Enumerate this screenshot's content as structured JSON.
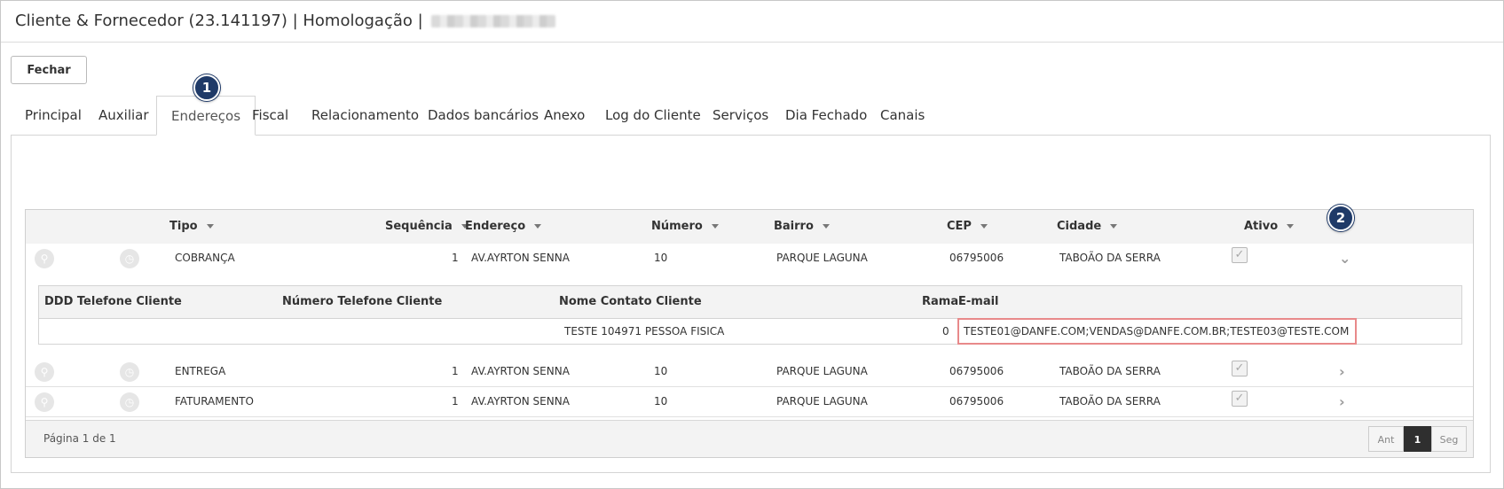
{
  "window": {
    "title": "Cliente & Fornecedor (23.141197) | Homologação |"
  },
  "toolbar": {
    "close_label": "Fechar"
  },
  "tabs": [
    {
      "label": "Principal"
    },
    {
      "label": "Auxiliar"
    },
    {
      "label": "Endereços",
      "active": true
    },
    {
      "label": "Fiscal"
    },
    {
      "label": "Relacionamento"
    },
    {
      "label": "Dados bancários"
    },
    {
      "label": "Anexo"
    },
    {
      "label": "Log do Cliente"
    },
    {
      "label": "Serviços"
    },
    {
      "label": "Dia Fechado"
    },
    {
      "label": "Canais"
    }
  ],
  "markers": [
    "1",
    "2"
  ],
  "grid": {
    "columns": [
      "Tipo",
      "Sequência",
      "Endereço",
      "Número",
      "Bairro",
      "CEP",
      "Cidade",
      "Ativo"
    ],
    "rows": [
      {
        "tipo": "COBRANÇA",
        "sequencia": "1",
        "endereco": "AV.AYRTON SENNA",
        "numero": "10",
        "bairro": "PARQUE LAGUNA",
        "cep": "06795006",
        "cidade": "TABOÃO DA SERRA",
        "ativo": true,
        "expanded": true
      },
      {
        "tipo": "ENTREGA",
        "sequencia": "1",
        "endereco": "AV.AYRTON SENNA",
        "numero": "10",
        "bairro": "PARQUE LAGUNA",
        "cep": "06795006",
        "cidade": "TABOÃO DA SERRA",
        "ativo": true,
        "expanded": false
      },
      {
        "tipo": "FATURAMENTO",
        "sequencia": "1",
        "endereco": "AV.AYRTON SENNA",
        "numero": "10",
        "bairro": "PARQUE LAGUNA",
        "cep": "06795006",
        "cidade": "TABOÃO DA SERRA",
        "ativo": true,
        "expanded": false
      }
    ],
    "detail": {
      "columns": [
        "DDD Telefone Cliente",
        "Número Telefone Cliente",
        "Nome Contato Cliente",
        "Ramal",
        "E-mail"
      ],
      "row": {
        "ddd": "",
        "numero": "",
        "contato": "TESTE 104971 PESSOA FISICA",
        "ramal": "0",
        "email": "TESTE01@DANFE.COM;VENDAS@DANFE.COM.BR;TESTE03@TESTE.COM"
      }
    },
    "footer": {
      "page_info": "Página 1 de 1",
      "prev_label": "Ant",
      "current_page": "1",
      "next_label": "Seg"
    }
  },
  "icons": {
    "view": "search-icon",
    "history": "clock-icon",
    "active": "checkbox-checked-icon",
    "expand": "chevron-right-icon",
    "collapse": "chevron-down-icon"
  },
  "colors": {
    "marker": "#1f3a68",
    "email_highlight": "#e8898a",
    "current_page": "#2f2f2f"
  }
}
